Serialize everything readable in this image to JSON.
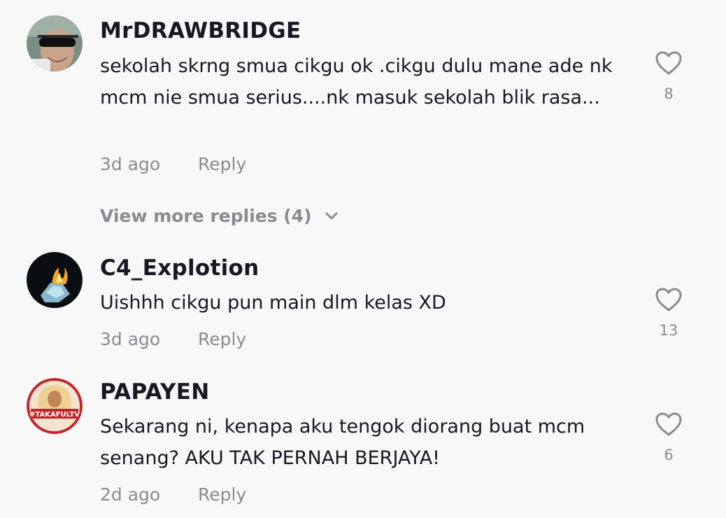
{
  "comments": [
    {
      "username": "MrDRAWBRIDGE",
      "text": "sekolah skrng smua cikgu ok .cikgu dulu mane ade nk mcm nie smua serius....nk masuk sekolah blik rasa...",
      "time": "3d ago",
      "reply_label": "Reply",
      "likes": "8"
    },
    {
      "username": "C4_Explotion",
      "text": "Uishhh cikgu pun main dlm kelas XD",
      "time": "3d ago",
      "reply_label": "Reply",
      "likes": "13"
    },
    {
      "username": "PAPAYEN",
      "text": "Sekarang ni, kenapa aku tengok diorang buat mcm senang? AKU TAK PERNAH BERJAYA!",
      "time": "2d ago",
      "reply_label": "Reply",
      "likes": "6",
      "avatar_text": "#TAKAFULTV"
    }
  ],
  "view_more_replies": "View more replies (4)",
  "icons": {
    "like": "heart-outline-icon",
    "expand": "chevron-down-icon"
  },
  "colors": {
    "background": "#f8f8f8",
    "text": "#161823",
    "muted": "#8a8b91"
  }
}
